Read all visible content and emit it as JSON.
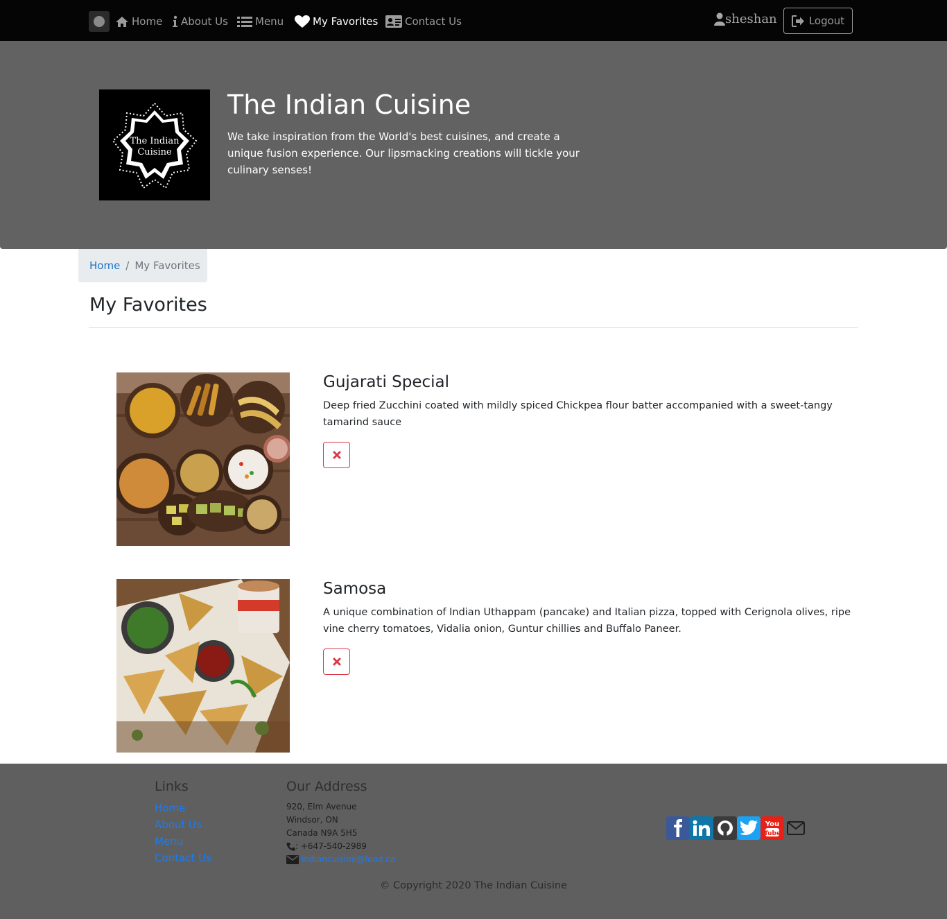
{
  "nav": {
    "items": [
      {
        "label": "Home",
        "icon": "home-icon"
      },
      {
        "label": "About Us",
        "icon": "info-icon"
      },
      {
        "label": "Menu",
        "icon": "list-icon"
      },
      {
        "label": "My Favorites",
        "icon": "heart-icon",
        "active": true
      },
      {
        "label": "Contact Us",
        "icon": "address-card-icon"
      }
    ],
    "user": "sheshan",
    "logout_label": "Logout"
  },
  "hero": {
    "title": "The Indian Cuisine",
    "text": "We take inspiration from the World's best cuisines, and create a unique fusion experience. Our lipsmacking creations will tickle your culinary senses!",
    "logo_text_line1": "The Indian",
    "logo_text_line2": "Cuisine"
  },
  "breadcrumb": {
    "home": "Home",
    "separator": "/",
    "current": "My Favorites"
  },
  "page_title": "My Favorites",
  "favorites": [
    {
      "name": "Gujarati Special",
      "description": "Deep fried Zucchini coated with mildly spiced Chickpea flour batter accompanied with a sweet-tangy tamarind sauce",
      "remove_icon": "close-icon"
    },
    {
      "name": "Samosa",
      "description": "A unique combination of Indian Uthappam (pancake) and Italian pizza, topped with Cerignola olives, ripe vine cherry tomatoes, Vidalia onion, Guntur chillies and Buffalo Paneer.",
      "remove_icon": "close-icon"
    }
  ],
  "footer": {
    "links_heading": "Links",
    "links": [
      "Home",
      "About Us",
      "Menu",
      "Contact Us"
    ],
    "address_heading": "Our Address",
    "address_lines": [
      "920, Elm Avenue",
      "Windsor, ON",
      "Canada N9A 5H5"
    ],
    "phone": ": +647-540-2989",
    "email": "indiancuisine@food.ca",
    "social": [
      "facebook-icon",
      "linkedin-icon",
      "github-icon",
      "twitter-icon",
      "youtube-icon",
      "envelope-icon"
    ],
    "copyright": "© Copyright 2020 The Indian Cuisine"
  },
  "colors": {
    "navbar": "#050505",
    "jumbotron": "#626262",
    "footer": "#5f5f5f",
    "link": "#1a73c7",
    "danger": "#dc3545"
  }
}
